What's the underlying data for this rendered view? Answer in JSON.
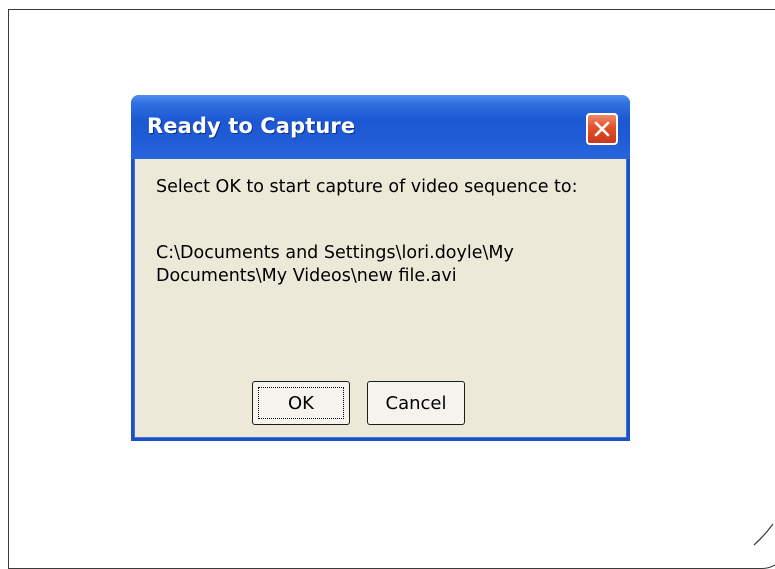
{
  "dialog": {
    "title": "Ready to Capture",
    "message": "Select OK to start capture of video sequence to:",
    "path": "C:\\Documents and Settings\\lori.doyle\\My Documents\\My Videos\\new file.avi",
    "buttons": {
      "ok": "OK",
      "cancel": "Cancel"
    },
    "close_icon": "close-icon"
  },
  "colors": {
    "titlebar": "#1c58d2",
    "dialog_face": "#ece9d8",
    "close_button": "#e0502b",
    "title_text": "#ffffff"
  }
}
